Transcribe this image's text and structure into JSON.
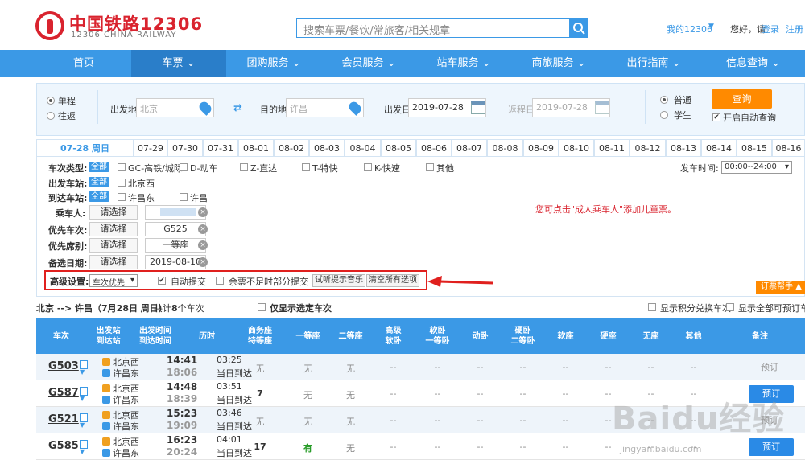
{
  "brand": {
    "cn": "中国铁路12306",
    "en": "12306 CHINA RAILWAY"
  },
  "search": {
    "placeholder": "搜索车票/餐饮/常旅客/相关规章"
  },
  "top_links": {
    "my": "我的12306",
    "hello": "您好，请",
    "login": "登录",
    "register": "注册"
  },
  "nav": [
    "首页",
    "车票",
    "团购服务",
    "会员服务",
    "站车服务",
    "商旅服务",
    "出行指南",
    "信息查询"
  ],
  "query": {
    "one_way": "单程",
    "round_trip": "往返",
    "from_label": "出发地",
    "from_value": "北京",
    "to_label": "目的地",
    "to_value": "许昌",
    "date_label": "出发日",
    "date_value": "2019-07-28",
    "return_label": "返程日",
    "return_value": "2019-07-28",
    "normal": "普通",
    "student": "学生",
    "query_btn": "查询",
    "auto_query": "开启自动查询"
  },
  "date_tabs": [
    "07-28 周日",
    "07-29",
    "07-30",
    "07-31",
    "08-01",
    "08-02",
    "08-03",
    "08-04",
    "08-05",
    "08-06",
    "08-07",
    "08-08",
    "08-09",
    "08-10",
    "08-11",
    "08-12",
    "08-13",
    "08-14",
    "08-15",
    "08-16"
  ],
  "filter": {
    "type_label": "车次类型:",
    "all": "全部",
    "types": [
      "GC-高铁/城际",
      "D-动车",
      "Z-直达",
      "T-特快",
      "K-快速",
      "其他"
    ],
    "depart_time_label": "发车时间:",
    "depart_time_value": "00:00--24:00",
    "from_station_label": "出发车站:",
    "from_stations": [
      "北京西"
    ],
    "to_station_label": "到达车站:",
    "to_stations": [
      "许昌东",
      "许昌"
    ],
    "passenger_label": "乘车人:",
    "pick": "请选择",
    "prio_train_label": "优先车次:",
    "prio_train_value": "G525",
    "prio_seat_label": "优先席别:",
    "prio_seat_value": "一等座",
    "alt_date_label": "备选日期:",
    "alt_date_value": "2019-08-10",
    "child_notice": "您可点击\"成人乘车人\"添加儿童票。",
    "adv_label": "高级设置:",
    "adv_select": "车次优先",
    "auto_submit": "自动提交",
    "partial_submit": "余票不足时部分提交",
    "listen_music": "试听提示音乐",
    "clear_all": "清空所有选项",
    "helper": "订票帮手"
  },
  "summary": {
    "route": "北京 --> 许昌（7月28日 周日）",
    "count_prefix": "共计",
    "count": "8",
    "count_suffix": "个车次",
    "only_selected": "仅显示选定车次",
    "show_points": "显示积分兑换车次",
    "show_all": "显示全部可预订车次"
  },
  "table": {
    "headers": [
      "车次",
      "出发站\n到达站",
      "出发时间\n到达时间",
      "历时",
      "商务座\n特等座",
      "一等座",
      "二等座",
      "高级\n软卧",
      "软卧\n一等卧",
      "动卧",
      "硬卧\n二等卧",
      "软座",
      "硬座",
      "无座",
      "其他",
      "备注"
    ],
    "rows": [
      {
        "train": "G503",
        "from": "北京西",
        "to": "许昌东",
        "dep": "14:41",
        "arr": "18:06",
        "dur": "03:25",
        "arrive": "当日到达",
        "swz": "无",
        "ydz": "无",
        "edz": "无",
        "book": "预订",
        "bookable": false
      },
      {
        "train": "G587",
        "from": "北京西",
        "to": "许昌东",
        "dep": "14:48",
        "arr": "18:39",
        "dur": "03:51",
        "arrive": "当日到达",
        "swz": "7",
        "ydz": "无",
        "edz": "无",
        "book": "预订",
        "bookable": true
      },
      {
        "train": "G521",
        "from": "北京西",
        "to": "许昌东",
        "dep": "15:23",
        "arr": "19:09",
        "dur": "03:46",
        "arrive": "当日到达",
        "swz": "无",
        "ydz": "无",
        "edz": "无",
        "book": "预订",
        "bookable": false
      },
      {
        "train": "G585",
        "from": "北京西",
        "to": "许昌东",
        "dep": "16:23",
        "arr": "20:24",
        "dur": "04:01",
        "arrive": "当日到达",
        "swz": "17",
        "ydz": "有",
        "edz": "无",
        "book": "预订",
        "bookable": true
      }
    ],
    "dash": "--"
  },
  "watermark": {
    "main": "Baidu经验",
    "sub": "jingyan.baidu.com"
  },
  "colors": {
    "brand_red": "#d9232e",
    "nav_blue": "#3b99e6",
    "orange": "#ff8a00",
    "highlight": "#e0201e"
  }
}
